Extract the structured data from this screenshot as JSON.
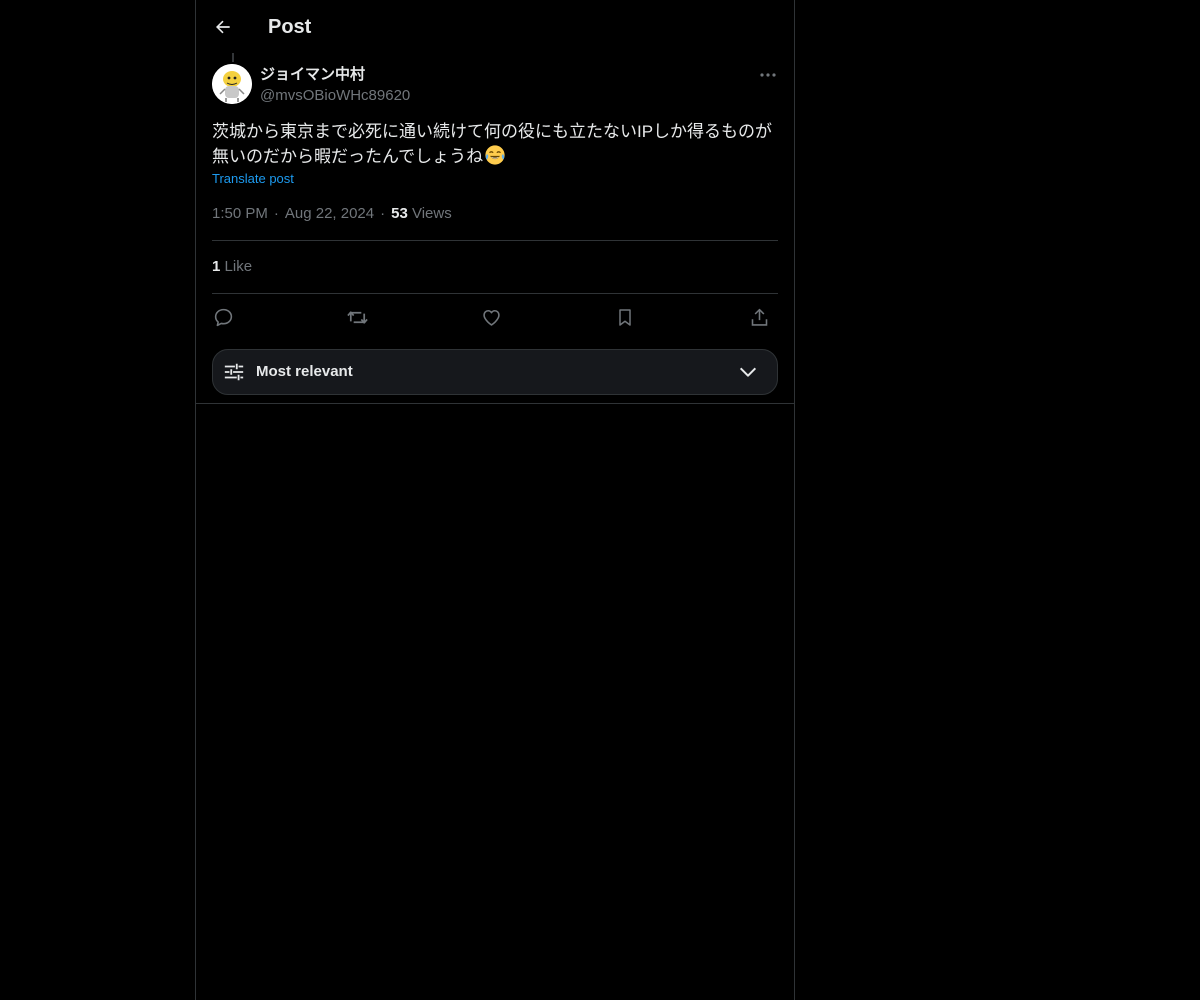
{
  "header": {
    "title": "Post",
    "back_icon": "arrow-left-icon"
  },
  "post": {
    "author_name": "ジョイマン中村",
    "author_handle": "@mvsOBioWHc89620",
    "text": "茨城から東京まで必死に通い続けて何の役にも立たないIPしか得るものが無いのだから暇だったんでしょうね",
    "emoji": "face-with-tears-of-joy-icon",
    "translate_label": "Translate post",
    "time": "1:50 PM",
    "date": "Aug 22, 2024",
    "separator": "·",
    "views_count": "53",
    "views_label": "Views",
    "likes_count": "1",
    "likes_label": "Like"
  },
  "actions": {
    "reply_icon": "reply-icon",
    "repost_icon": "repost-icon",
    "like_icon": "heart-icon",
    "bookmark_icon": "bookmark-icon",
    "share_icon": "share-icon"
  },
  "sort": {
    "label": "Most relevant",
    "icon": "sliders-icon",
    "chevron": "chevron-down-icon"
  },
  "colors": {
    "background": "#000000",
    "text_primary": "#e7e9ea",
    "text_secondary": "#71767b",
    "accent": "#1d9bf0",
    "border": "#2f3336"
  }
}
